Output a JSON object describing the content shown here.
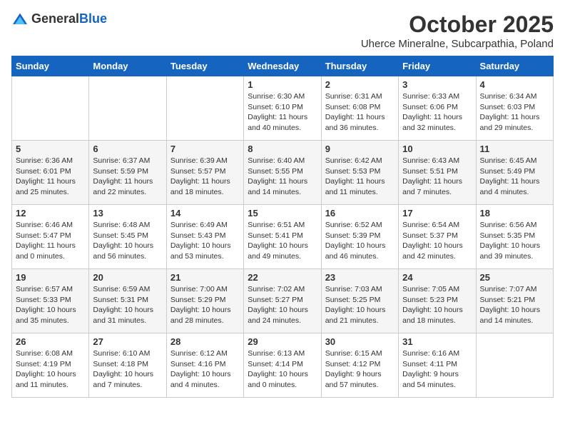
{
  "logo": {
    "general": "General",
    "blue": "Blue"
  },
  "title": "October 2025",
  "subtitle": "Uherce Mineralne, Subcarpathia, Poland",
  "days_of_week": [
    "Sunday",
    "Monday",
    "Tuesday",
    "Wednesday",
    "Thursday",
    "Friday",
    "Saturday"
  ],
  "weeks": [
    [
      {
        "day": "",
        "info": ""
      },
      {
        "day": "",
        "info": ""
      },
      {
        "day": "",
        "info": ""
      },
      {
        "day": "1",
        "info": "Sunrise: 6:30 AM\nSunset: 6:10 PM\nDaylight: 11 hours\nand 40 minutes."
      },
      {
        "day": "2",
        "info": "Sunrise: 6:31 AM\nSunset: 6:08 PM\nDaylight: 11 hours\nand 36 minutes."
      },
      {
        "day": "3",
        "info": "Sunrise: 6:33 AM\nSunset: 6:06 PM\nDaylight: 11 hours\nand 32 minutes."
      },
      {
        "day": "4",
        "info": "Sunrise: 6:34 AM\nSunset: 6:03 PM\nDaylight: 11 hours\nand 29 minutes."
      }
    ],
    [
      {
        "day": "5",
        "info": "Sunrise: 6:36 AM\nSunset: 6:01 PM\nDaylight: 11 hours\nand 25 minutes."
      },
      {
        "day": "6",
        "info": "Sunrise: 6:37 AM\nSunset: 5:59 PM\nDaylight: 11 hours\nand 22 minutes."
      },
      {
        "day": "7",
        "info": "Sunrise: 6:39 AM\nSunset: 5:57 PM\nDaylight: 11 hours\nand 18 minutes."
      },
      {
        "day": "8",
        "info": "Sunrise: 6:40 AM\nSunset: 5:55 PM\nDaylight: 11 hours\nand 14 minutes."
      },
      {
        "day": "9",
        "info": "Sunrise: 6:42 AM\nSunset: 5:53 PM\nDaylight: 11 hours\nand 11 minutes."
      },
      {
        "day": "10",
        "info": "Sunrise: 6:43 AM\nSunset: 5:51 PM\nDaylight: 11 hours\nand 7 minutes."
      },
      {
        "day": "11",
        "info": "Sunrise: 6:45 AM\nSunset: 5:49 PM\nDaylight: 11 hours\nand 4 minutes."
      }
    ],
    [
      {
        "day": "12",
        "info": "Sunrise: 6:46 AM\nSunset: 5:47 PM\nDaylight: 11 hours\nand 0 minutes."
      },
      {
        "day": "13",
        "info": "Sunrise: 6:48 AM\nSunset: 5:45 PM\nDaylight: 10 hours\nand 56 minutes."
      },
      {
        "day": "14",
        "info": "Sunrise: 6:49 AM\nSunset: 5:43 PM\nDaylight: 10 hours\nand 53 minutes."
      },
      {
        "day": "15",
        "info": "Sunrise: 6:51 AM\nSunset: 5:41 PM\nDaylight: 10 hours\nand 49 minutes."
      },
      {
        "day": "16",
        "info": "Sunrise: 6:52 AM\nSunset: 5:39 PM\nDaylight: 10 hours\nand 46 minutes."
      },
      {
        "day": "17",
        "info": "Sunrise: 6:54 AM\nSunset: 5:37 PM\nDaylight: 10 hours\nand 42 minutes."
      },
      {
        "day": "18",
        "info": "Sunrise: 6:56 AM\nSunset: 5:35 PM\nDaylight: 10 hours\nand 39 minutes."
      }
    ],
    [
      {
        "day": "19",
        "info": "Sunrise: 6:57 AM\nSunset: 5:33 PM\nDaylight: 10 hours\nand 35 minutes."
      },
      {
        "day": "20",
        "info": "Sunrise: 6:59 AM\nSunset: 5:31 PM\nDaylight: 10 hours\nand 31 minutes."
      },
      {
        "day": "21",
        "info": "Sunrise: 7:00 AM\nSunset: 5:29 PM\nDaylight: 10 hours\nand 28 minutes."
      },
      {
        "day": "22",
        "info": "Sunrise: 7:02 AM\nSunset: 5:27 PM\nDaylight: 10 hours\nand 24 minutes."
      },
      {
        "day": "23",
        "info": "Sunrise: 7:03 AM\nSunset: 5:25 PM\nDaylight: 10 hours\nand 21 minutes."
      },
      {
        "day": "24",
        "info": "Sunrise: 7:05 AM\nSunset: 5:23 PM\nDaylight: 10 hours\nand 18 minutes."
      },
      {
        "day": "25",
        "info": "Sunrise: 7:07 AM\nSunset: 5:21 PM\nDaylight: 10 hours\nand 14 minutes."
      }
    ],
    [
      {
        "day": "26",
        "info": "Sunrise: 6:08 AM\nSunset: 4:19 PM\nDaylight: 10 hours\nand 11 minutes."
      },
      {
        "day": "27",
        "info": "Sunrise: 6:10 AM\nSunset: 4:18 PM\nDaylight: 10 hours\nand 7 minutes."
      },
      {
        "day": "28",
        "info": "Sunrise: 6:12 AM\nSunset: 4:16 PM\nDaylight: 10 hours\nand 4 minutes."
      },
      {
        "day": "29",
        "info": "Sunrise: 6:13 AM\nSunset: 4:14 PM\nDaylight: 10 hours\nand 0 minutes."
      },
      {
        "day": "30",
        "info": "Sunrise: 6:15 AM\nSunset: 4:12 PM\nDaylight: 9 hours\nand 57 minutes."
      },
      {
        "day": "31",
        "info": "Sunrise: 6:16 AM\nSunset: 4:11 PM\nDaylight: 9 hours\nand 54 minutes."
      },
      {
        "day": "",
        "info": ""
      }
    ]
  ]
}
